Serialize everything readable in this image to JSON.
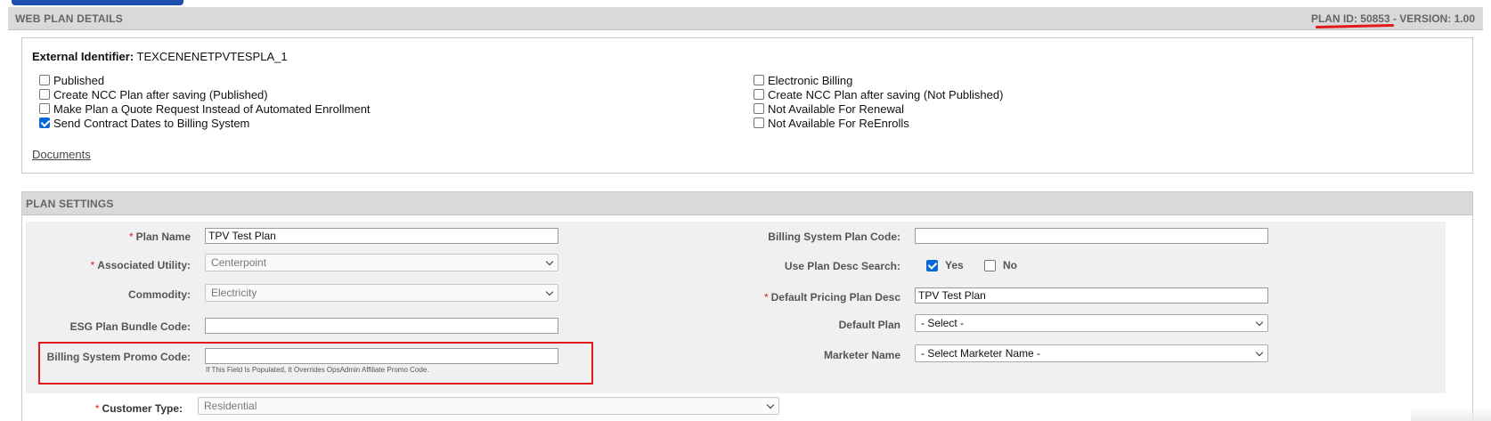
{
  "web_plan": {
    "section_title": "WEB PLAN DETAILS",
    "plan_id_version": "PLAN ID: 50853 - VERSION: 1.00",
    "external_identifier_label": "External Identifier:",
    "external_identifier_value": "TEXCENENETPVTESPLA_1",
    "left_checkboxes": [
      {
        "label": "Published",
        "checked": false
      },
      {
        "label": "Create NCC Plan after saving (Published)",
        "checked": false
      },
      {
        "label": "Make Plan a Quote Request Instead of Automated Enrollment",
        "checked": false
      },
      {
        "label": "Send Contract Dates to Billing System",
        "checked": true
      }
    ],
    "right_checkboxes": [
      {
        "label": "Electronic Billing",
        "checked": false
      },
      {
        "label": "Create NCC Plan after saving (Not Published)",
        "checked": false
      },
      {
        "label": "Not Available For Renewal",
        "checked": false
      },
      {
        "label": "Not Available For ReEnrolls",
        "checked": false
      }
    ],
    "documents_link": "Documents"
  },
  "plan_settings": {
    "section_title": "PLAN SETTINGS",
    "required_mark": "*",
    "plan_name_label": "Plan Name",
    "plan_name_value": "TPV Test Plan",
    "associated_utility_label": "Associated Utility:",
    "associated_utility_value": "Centerpoint",
    "commodity_label": "Commodity:",
    "commodity_value": "Electricity",
    "esg_label": "ESG Plan Bundle Code:",
    "esg_value": "",
    "promo_label": "Billing System Promo Code:",
    "promo_value": "",
    "promo_hint": "If This Field Is Populated, It Overrides OpsAdmin Affiliate Promo Code.",
    "billing_plan_code_label": "Billing System Plan Code:",
    "billing_plan_code_value": "",
    "use_plan_desc_label": "Use Plan Desc Search:",
    "yes_label": "Yes",
    "no_label": "No",
    "use_plan_desc_yes": true,
    "use_plan_desc_no": false,
    "default_pricing_label": "Default Pricing Plan Desc",
    "default_pricing_value": "TPV Test Plan",
    "default_plan_label": "Default Plan",
    "default_plan_value": "- Select -",
    "marketer_name_label": "Marketer Name",
    "marketer_name_value": "- Select Marketer Name -",
    "customer_type_label": "Customer Type:",
    "customer_type_value": "Residential"
  },
  "colors": {
    "header_bg": "#d9d9d9",
    "panel_bg": "#f0f0f0",
    "required": "#d71f1f",
    "annotation_red": "#e21a1a",
    "checkbox_blue": "#0a68d6"
  }
}
